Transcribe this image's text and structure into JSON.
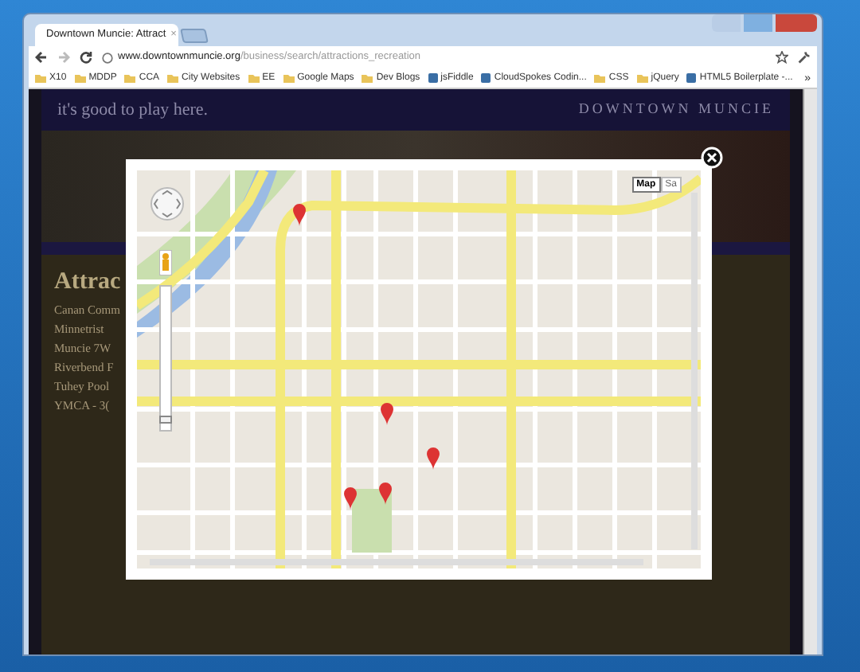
{
  "browser": {
    "tabs": [
      {
        "title": "Downtown Muncie: Attract",
        "selected": true,
        "close": "×"
      }
    ],
    "address": {
      "host": "www.downtownmuncie.org",
      "path": "/business/search/attractions_recreation"
    },
    "bookmarks": [
      {
        "kind": "folder",
        "label": "X10"
      },
      {
        "kind": "folder",
        "label": "MDDP"
      },
      {
        "kind": "folder",
        "label": "CCA"
      },
      {
        "kind": "folder",
        "label": "City Websites"
      },
      {
        "kind": "folder",
        "label": "EE"
      },
      {
        "kind": "folder",
        "label": "Google Maps"
      },
      {
        "kind": "folder",
        "label": "Dev Blogs"
      },
      {
        "kind": "site",
        "label": "jsFiddle"
      },
      {
        "kind": "site",
        "label": "CloudSpokes Codin..."
      },
      {
        "kind": "folder",
        "label": "CSS"
      },
      {
        "kind": "folder",
        "label": "jQuery"
      },
      {
        "kind": "site",
        "label": "HTML5 Boilerplate -..."
      }
    ],
    "overflow": "»"
  },
  "site": {
    "tagline": "it's good to play here.",
    "brand": "DOWNTOWN MUNCIE",
    "heading": "Attrac",
    "items": [
      "Canan Comm",
      "Minnetrist",
      "Muncie 7W",
      "Riverbend F",
      "Tuhey Pool",
      "YMCA - 3("
    ]
  },
  "lightbox": {
    "map_type": [
      {
        "label": "Map",
        "selected": true
      },
      {
        "label": "Sa",
        "selected": false
      }
    ],
    "zoom": {
      "level": 0.05
    }
  }
}
